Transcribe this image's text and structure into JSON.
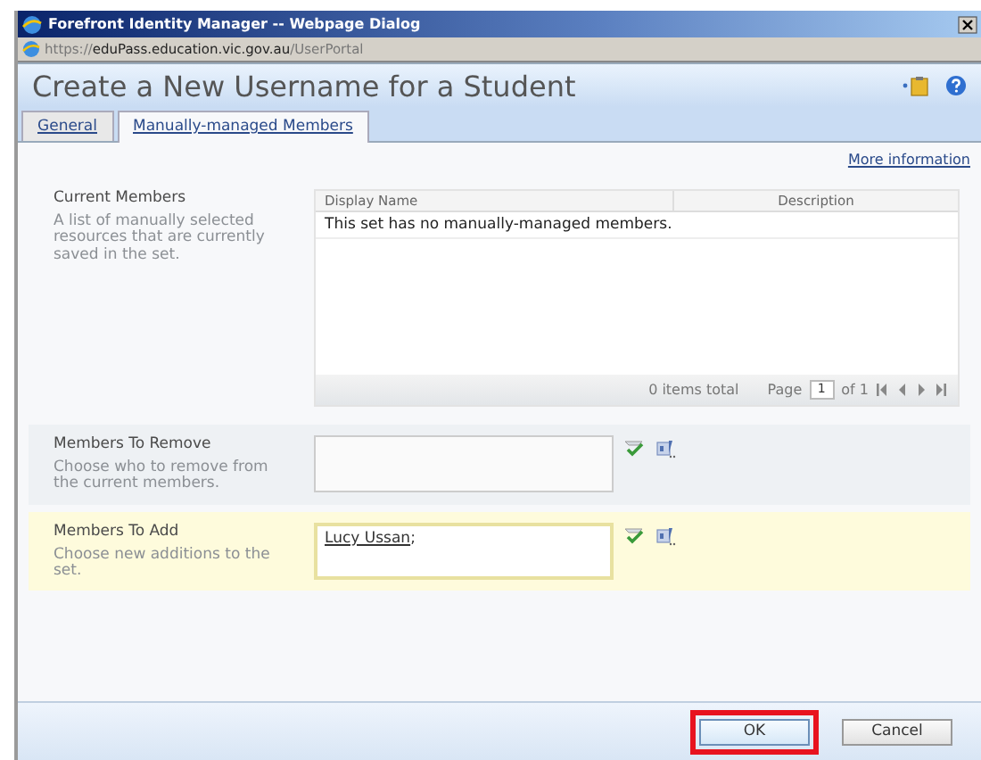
{
  "window": {
    "title": "Forefront Identity Manager -- Webpage Dialog"
  },
  "address": "https://**eduPass.education.vic.gov.au**/UserPortal",
  "header": {
    "title": "Create a New Username for a Student"
  },
  "tabs": [
    {
      "label": "General",
      "selected": false
    },
    {
      "label": "Manually-managed Members",
      "selected": true
    }
  ],
  "more_info": "More information",
  "sections": [
    {
      "kind": "grid",
      "title": "Current Members",
      "description": "A list of manually selected resources that are currently saved in the set.",
      "highlighted": false,
      "grid": {
        "columns": [
          "Display Name",
          "Description"
        ],
        "empty_message": "This set has no manually-managed members.",
        "total": "0 items total",
        "page_label": "Page",
        "page": "1",
        "of": "of 1"
      }
    },
    {
      "kind": "picker",
      "title": "Members To Remove",
      "description": "Choose who to remove from the current members.",
      "highlighted": false
    },
    {
      "kind": "picker",
      "title": "Members To Add",
      "description": "Choose new additions to the set.",
      "highlighted": true,
      "entries": [
        {
          "name": "Lucy Ussan",
          "separator": ";"
        }
      ]
    }
  ],
  "buttons": [
    {
      "label": "OK",
      "annotated": true
    },
    {
      "label": "Cancel",
      "annotated": false
    }
  ]
}
